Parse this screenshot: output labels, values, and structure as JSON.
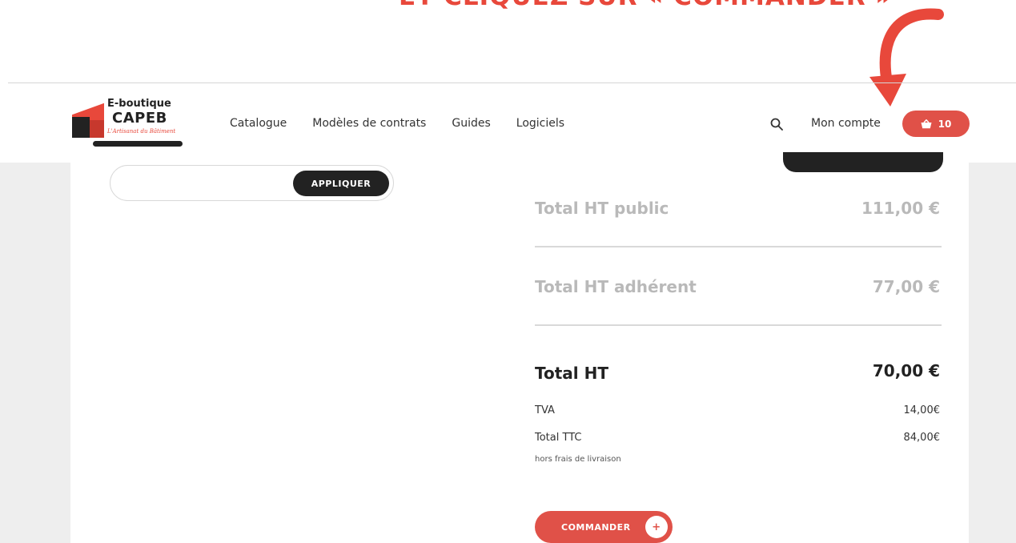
{
  "instruction": {
    "text": "ET CLIQUEZ SUR « COMMANDER »"
  },
  "colors": {
    "accent": "#e05148",
    "dark": "#222222",
    "muted": "#b9b9b9"
  },
  "header": {
    "logo": {
      "line1": "E-boutique",
      "line2": "CAPEB",
      "tagline": "L'Artisanat du Bâtiment"
    },
    "nav": [
      "Catalogue",
      "Modèles de contrats",
      "Guides",
      "Logiciels"
    ],
    "search_icon": "search-icon",
    "account": "Mon compte",
    "cart": {
      "icon": "basket-icon",
      "count": "10"
    }
  },
  "coupon": {
    "value": "",
    "placeholder": "",
    "apply_label": "APPLIQUER"
  },
  "summary": {
    "public": {
      "label": "Total HT public",
      "value": "111,00 €"
    },
    "member": {
      "label": "Total HT adhérent",
      "value": "77,00 €"
    },
    "total_ht": {
      "label": "Total HT",
      "value": "70,00 €"
    },
    "tva": {
      "label": "TVA",
      "value": "14,00€"
    },
    "total_ttc": {
      "label": "Total TTC",
      "value": "84,00€",
      "note": "hors frais de livraison"
    }
  },
  "order_button": {
    "label": "COMMANDER",
    "icon": "+"
  }
}
